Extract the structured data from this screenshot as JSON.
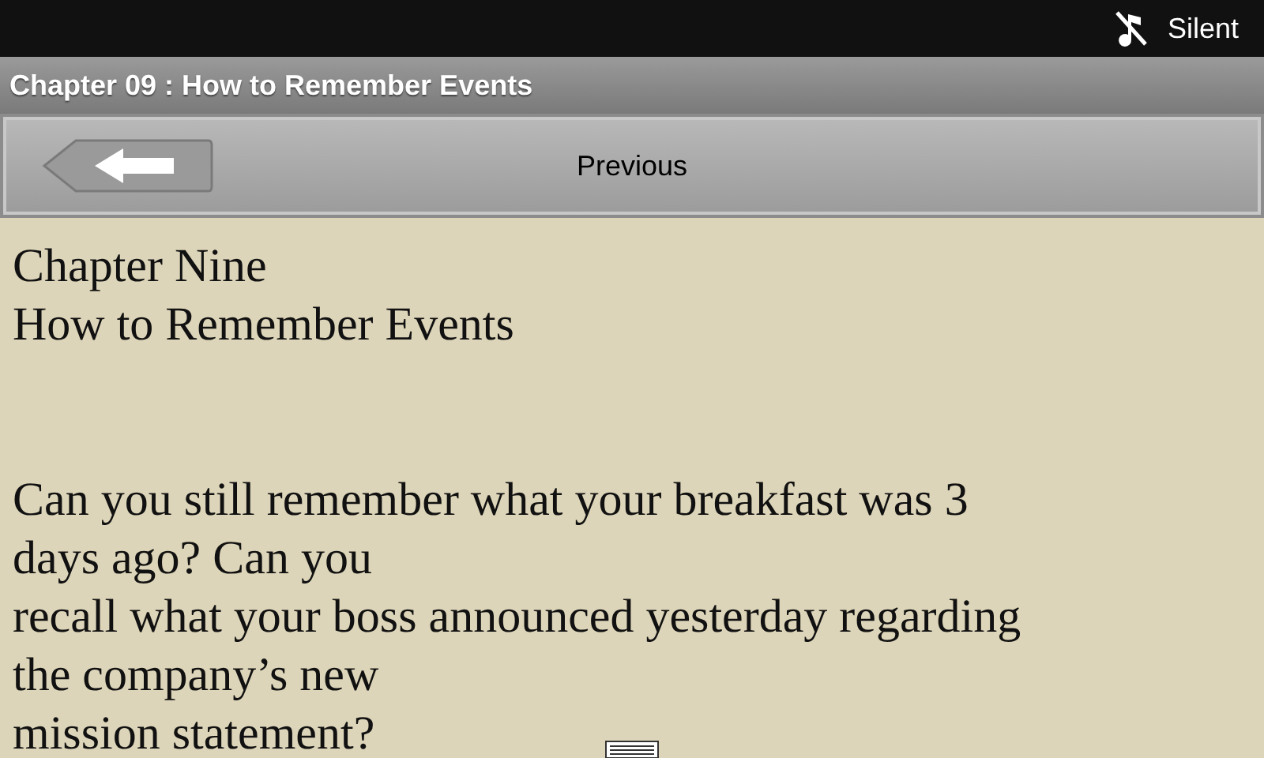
{
  "status_bar": {
    "mode": "Silent"
  },
  "title_bar": {
    "title": "Chapter 09 : How to Remember Events"
  },
  "nav": {
    "label": "Previous"
  },
  "content": {
    "heading_lines": [
      "Chapter Nine",
      "How to Remember Events"
    ],
    "paragraph_lines": [
      "Can you still remember what your breakfast was 3",
      "days ago? Can you",
      "recall what your boss announced yesterday regarding",
      "the company’s new",
      "mission statement?"
    ]
  }
}
